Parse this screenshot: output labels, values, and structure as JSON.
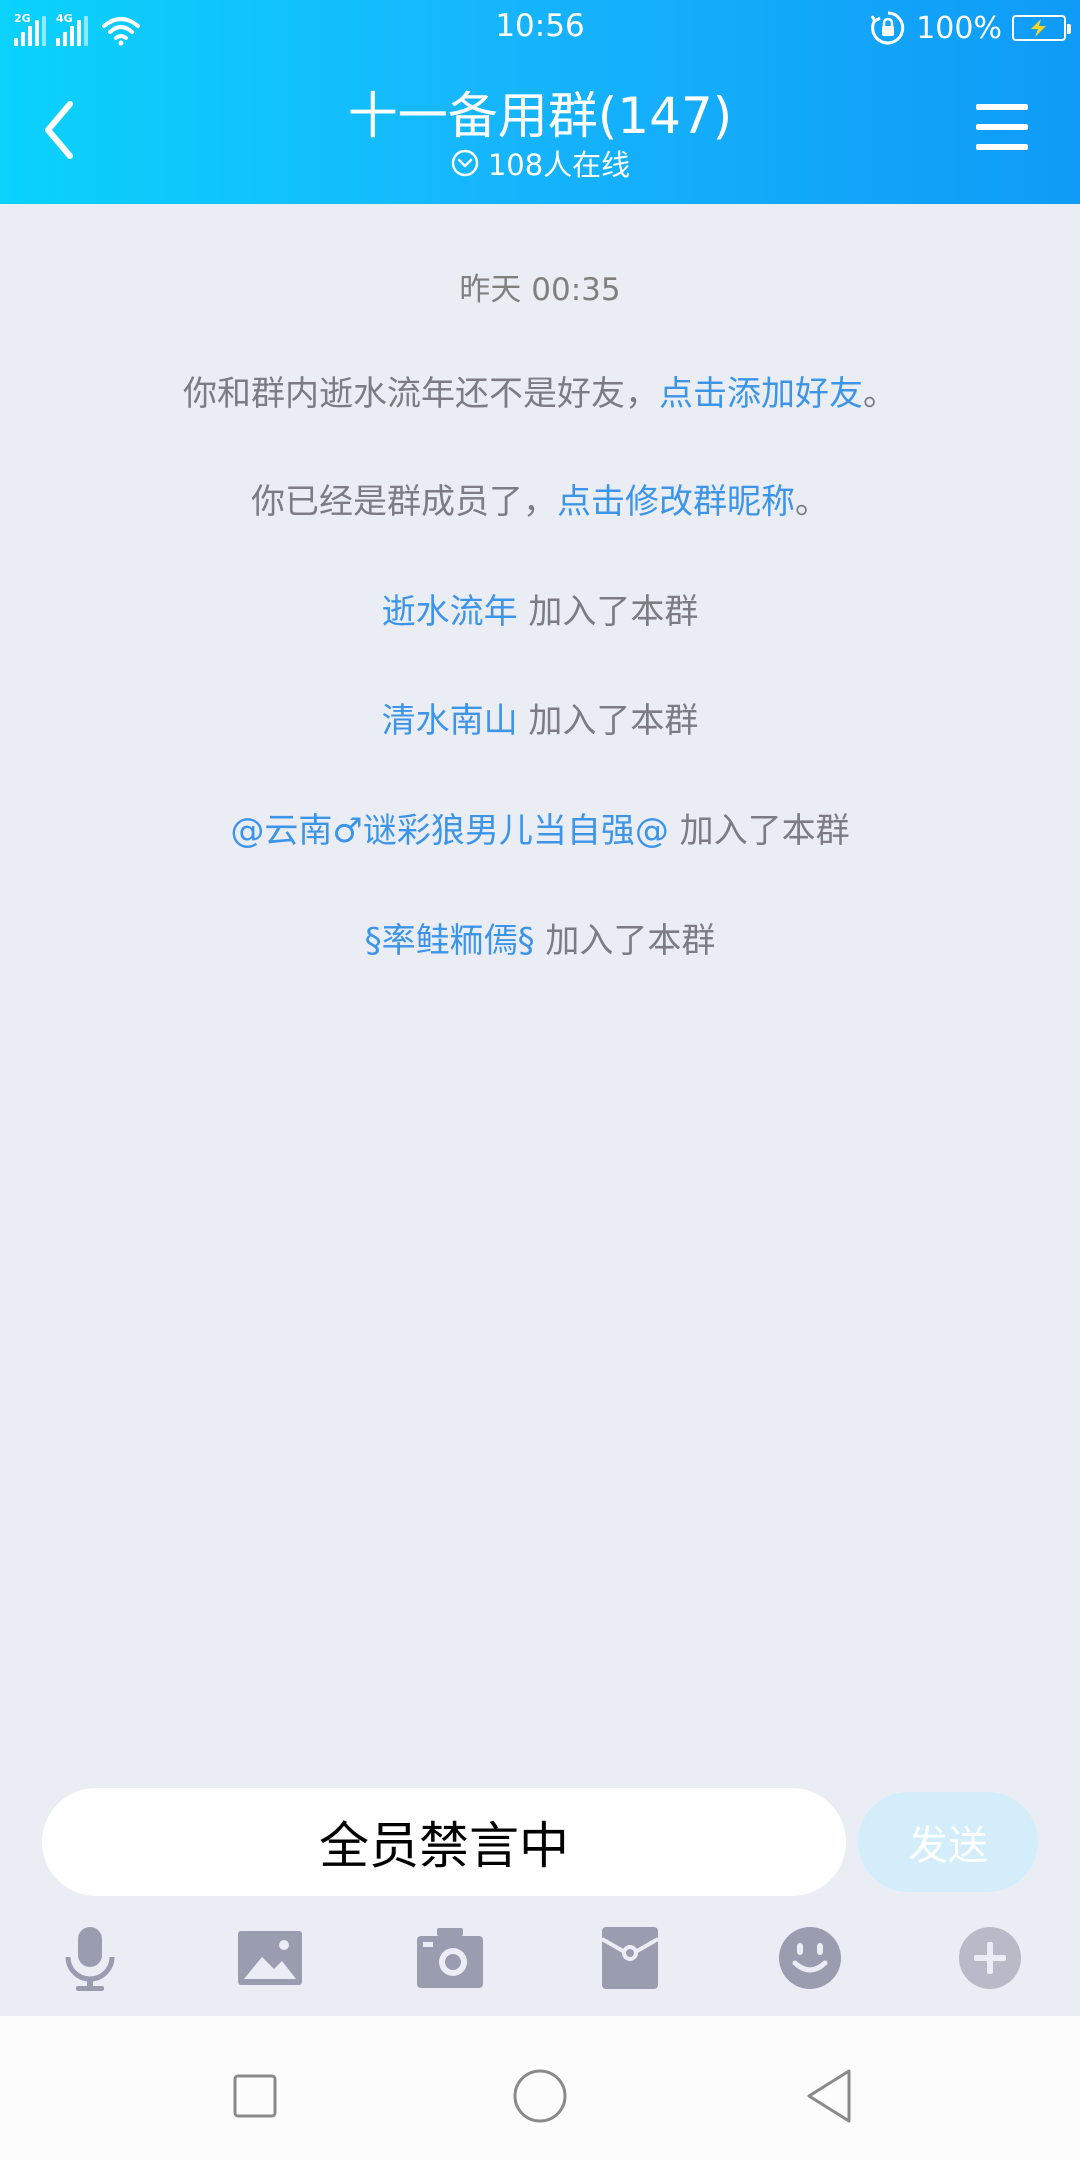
{
  "status_bar": {
    "net1": "2G",
    "net2": "4G",
    "time": "10:56",
    "battery_percent": "100%",
    "icons": [
      "signal-icon",
      "wifi-icon",
      "rotation-lock-icon",
      "battery-icon"
    ]
  },
  "header": {
    "title": "十一备用群(147)",
    "online": "108人在线",
    "icons": [
      "back-icon",
      "menu-icon",
      "chevron-down-circle-icon"
    ]
  },
  "chat": {
    "timestamp": "昨天 00:35",
    "notice1": {
      "text": "你和群内逝水流年还不是好友，",
      "link": "点击添加好友",
      "end": "。"
    },
    "notice2": {
      "text": "你已经是群成员了，",
      "link": "点击修改群昵称",
      "end": "。"
    },
    "joins": [
      {
        "name": "逝水流年",
        "action": " 加入了本群"
      },
      {
        "name": "清水南山",
        "action": " 加入了本群"
      },
      {
        "name": "@云南♂谜彩狼男儿当自强@",
        "action": " 加入了本群"
      },
      {
        "name": "§率鲑粫傿§",
        "action": " 加入了本群"
      }
    ]
  },
  "input": {
    "muted_text": "全员禁言中",
    "send_label": "发送"
  },
  "toolbar": {
    "icons": [
      "microphone-icon",
      "image-icon",
      "camera-icon",
      "red-packet-icon",
      "emoji-icon",
      "plus-icon"
    ]
  },
  "colors": {
    "header_start": "#0ad2fb",
    "header_end": "#0f9bf7",
    "link": "#3d95e8",
    "background": "#ebedf5",
    "send_disabled": "#d3eefa",
    "toolbar_icon": "#9a9cb0"
  },
  "navbar": {
    "icons": [
      "recent-apps-icon",
      "home-icon",
      "nav-back-icon"
    ]
  }
}
